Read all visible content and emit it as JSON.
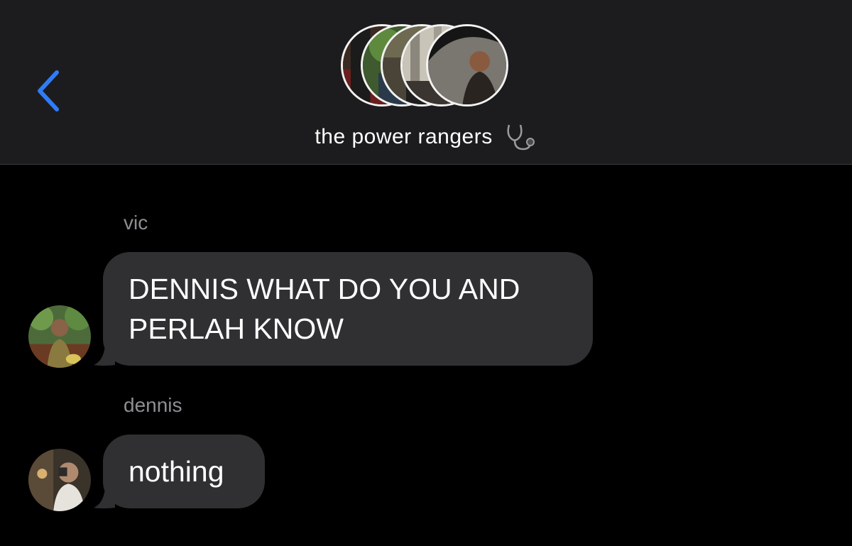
{
  "header": {
    "back_icon": "chevron-left-icon",
    "group_title": "the power rangers",
    "title_emoji": "stethoscope-icon",
    "accent_color": "#2f7cf6",
    "group_avatar_count": 5
  },
  "messages": [
    {
      "sender": "vic",
      "text_line1": "DENNIS WHAT DO YOU AND",
      "text_line2": "PERLAH KNOW"
    },
    {
      "sender": "dennis",
      "text": "nothing"
    }
  ],
  "colors": {
    "header_bg": "#1c1c1e",
    "bubble_bg": "#303033",
    "sender_text": "#8e8e93"
  }
}
